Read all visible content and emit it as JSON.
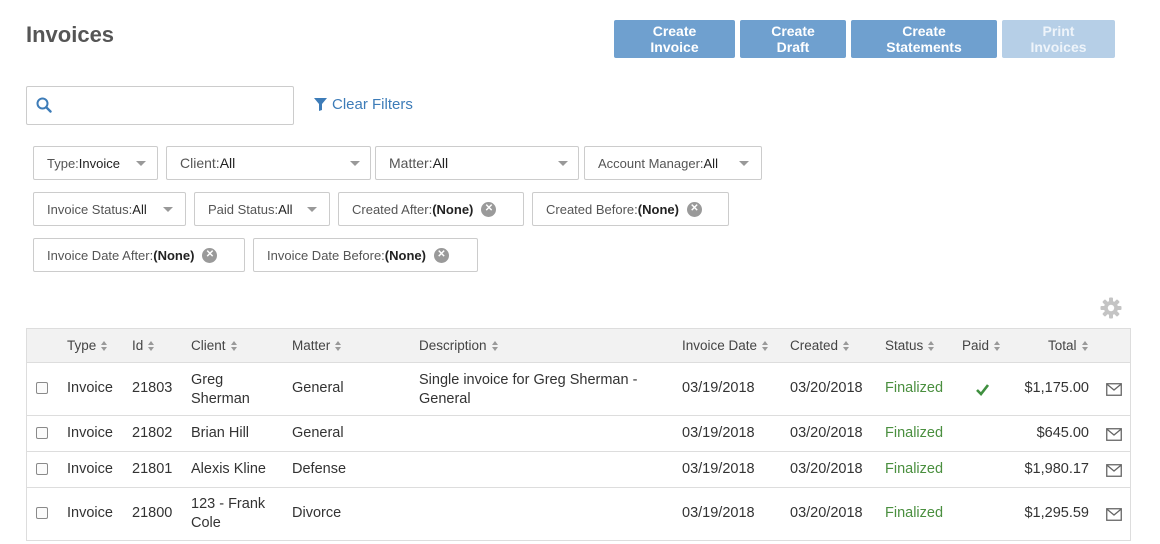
{
  "page": {
    "title": "Invoices"
  },
  "actions": {
    "create_invoice": "Create Invoice",
    "create_draft": "Create Draft",
    "create_statements": "Create Statements",
    "print_invoices": "Print Invoices"
  },
  "search": {
    "value": "",
    "placeholder": ""
  },
  "clear_filters": "Clear Filters",
  "filters": {
    "type": {
      "label": "Type:",
      "value": "Invoice"
    },
    "client": {
      "label": "Client: ",
      "value": "All"
    },
    "matter": {
      "label": "Matter: ",
      "value": "All"
    },
    "account_manager": {
      "label": "Account Manager:",
      "value": "All"
    },
    "invoice_status": {
      "label": "Invoice Status:",
      "value": "All"
    },
    "paid_status": {
      "label": "Paid Status:",
      "value": "All"
    },
    "created_after": {
      "label": "Created After: ",
      "value": "(None)"
    },
    "created_before": {
      "label": "Created Before: ",
      "value": "(None)"
    },
    "invoice_date_after": {
      "label": "Invoice Date After: ",
      "value": "(None)"
    },
    "invoice_date_before": {
      "label": "Invoice Date Before: ",
      "value": "(None)"
    }
  },
  "table": {
    "columns": {
      "type": "Type",
      "id": "Id",
      "client": "Client",
      "matter": "Matter",
      "description": "Description",
      "invoice_date": "Invoice Date",
      "created": "Created",
      "status": "Status",
      "paid": "Paid",
      "total": "Total"
    },
    "rows": [
      {
        "type": "Invoice",
        "id": "21803",
        "client": "Greg Sherman",
        "matter": "General",
        "description": "Single invoice for Greg Sherman - General",
        "invoice_date": "03/19/2018",
        "created": "03/20/2018",
        "status": "Finalized",
        "paid": true,
        "total": "$1,175.00"
      },
      {
        "type": "Invoice",
        "id": "21802",
        "client": "Brian Hill",
        "matter": "General",
        "description": "",
        "invoice_date": "03/19/2018",
        "created": "03/20/2018",
        "status": "Finalized",
        "paid": false,
        "total": "$645.00"
      },
      {
        "type": "Invoice",
        "id": "21801",
        "client": "Alexis Kline",
        "matter": "Defense",
        "description": "",
        "invoice_date": "03/19/2018",
        "created": "03/20/2018",
        "status": "Finalized",
        "paid": false,
        "total": "$1,980.17"
      },
      {
        "type": "Invoice",
        "id": "21800",
        "client": "123 - Frank Cole",
        "matter": "Divorce",
        "description": "",
        "invoice_date": "03/19/2018",
        "created": "03/20/2018",
        "status": "Finalized",
        "paid": false,
        "total": "$1,295.59"
      }
    ]
  },
  "colors": {
    "primary_button": "#6fa0cf",
    "primary_button_disabled": "#b6cfe7",
    "link": "#3d7cb8",
    "status_finalized": "#4a8f3f",
    "paid_check": "#3f8f3f"
  },
  "icons": {
    "search": "search-icon",
    "filter": "filter-icon",
    "settings": "gear-icon",
    "paid": "check-icon",
    "email": "mail-icon",
    "dropdown": "caret-down-icon",
    "clear": "clear-circle-icon"
  }
}
